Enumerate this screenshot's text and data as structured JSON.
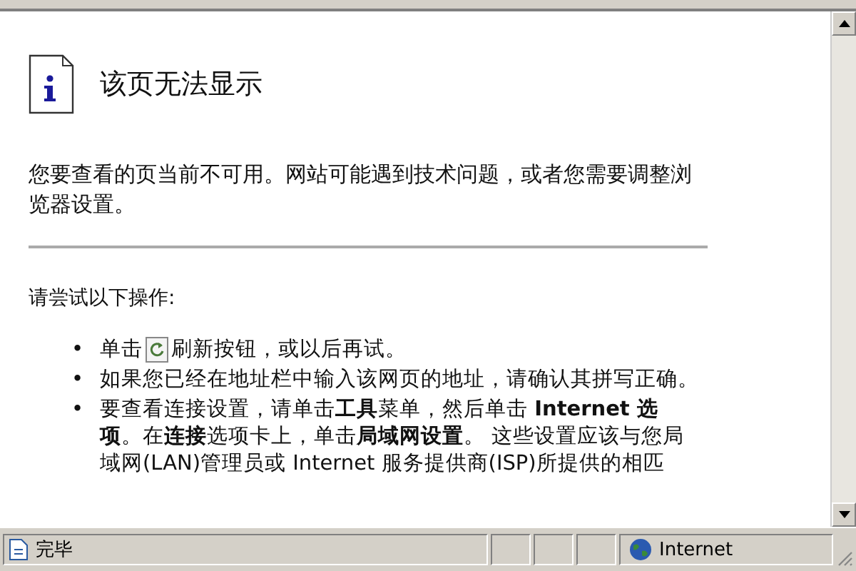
{
  "page": {
    "title": "该页无法显示",
    "message": "您要查看的页当前不可用。网站可能遇到技术问题，或者您需要调整浏览器设置。",
    "try_heading": "请尝试以下操作:",
    "suggestions": [
      {
        "kind": "refresh",
        "marker": "•",
        "before": "单击",
        "after": "刷新按钮，或以后再试。"
      },
      {
        "kind": "text",
        "marker": "•",
        "text": "如果您已经在地址栏中输入该网页的地址，请确认其拼写正确。"
      },
      {
        "kind": "text",
        "marker": "•",
        "text": "要查看连接设置，请单击**工具**菜单，然后单击 **Internet 选项**。在**连接**选项卡上，单击**局域网设置**。 这些设置应该与您局域网(LAN)管理员或 Internet 服务提供商(ISP)所提供的相匹"
      }
    ]
  },
  "status_bar": {
    "text": "完毕",
    "zone": "Internet"
  }
}
